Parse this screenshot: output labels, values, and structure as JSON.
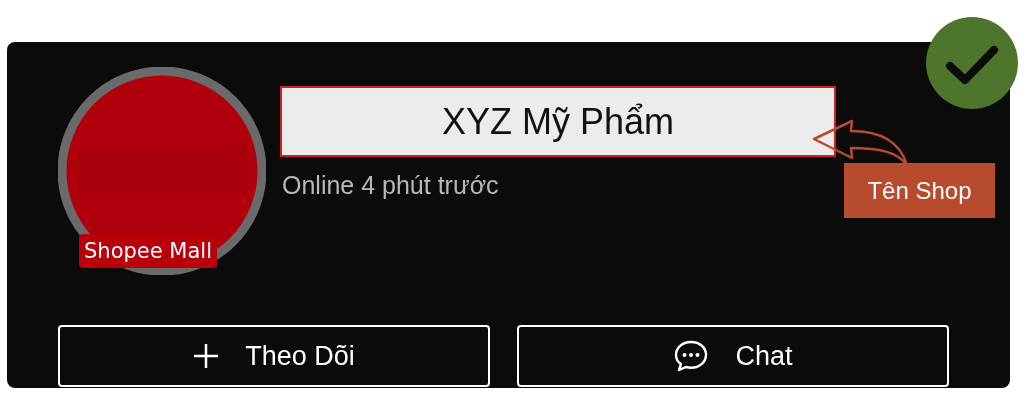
{
  "shop": {
    "badge": "Shopee Mall",
    "name": "XYZ Mỹ Phẩm",
    "status": "Online 4 phút trước"
  },
  "annotation": {
    "label": "Tên Shop"
  },
  "buttons": [
    {
      "kind": "follow",
      "label": "Theo Dõi"
    },
    {
      "kind": "chat",
      "label": "Chat"
    }
  ]
}
